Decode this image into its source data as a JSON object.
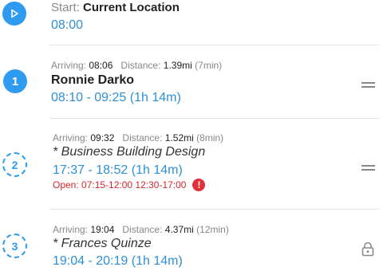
{
  "start": {
    "prefix": "Start:",
    "location": "Current Location",
    "time": "08:00"
  },
  "stops": [
    {
      "number": "1",
      "arriving_label": "Arriving:",
      "arriving": "08:06",
      "distance_label": "Distance:",
      "distance": "1.39mi",
      "duration": "(7min)",
      "name": "Ronnie Darko",
      "window": "08:10 - 09:25 (1h 14m)",
      "action_icon": "drag-handle-icon"
    },
    {
      "number": "2",
      "arriving_label": "Arriving:",
      "arriving": "09:32",
      "distance_label": "Distance:",
      "distance": "1.52mi",
      "duration": "(8min)",
      "name": "* Business Building Design",
      "window": "17:37 - 18:52 (1h 14m)",
      "warning": "Open: 07:15-12:00 12:30-17:00",
      "warning_icon": "!",
      "action_icon": "drag-handle-icon"
    },
    {
      "number": "3",
      "arriving_label": "Arriving:",
      "arriving": "19:04",
      "distance_label": "Distance:",
      "distance": "4.37mi",
      "duration": "(12min)",
      "name": "* Frances Quinze",
      "window": "19:04 - 20:19 (1h 14m)",
      "action_icon": "lock-icon"
    }
  ],
  "colors": {
    "accent": "#2e9bf0",
    "time_text": "#2e8fd8",
    "warning": "#d9252a"
  }
}
